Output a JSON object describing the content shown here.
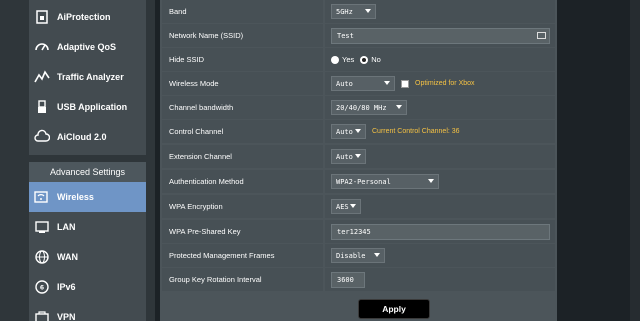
{
  "sidebar": {
    "items": [
      {
        "label": "AiProtection",
        "icon": "shield-icon"
      },
      {
        "label": "Adaptive QoS",
        "icon": "gauge-icon"
      },
      {
        "label": "Traffic Analyzer",
        "icon": "chart-icon"
      },
      {
        "label": "USB Application",
        "icon": "usb-icon"
      },
      {
        "label": "AiCloud 2.0",
        "icon": "cloud-icon"
      }
    ],
    "advanced_header": "Advanced Settings",
    "advanced_items": [
      {
        "label": "Wireless",
        "icon": "wifi-icon",
        "active": true
      },
      {
        "label": "LAN",
        "icon": "lan-icon"
      },
      {
        "label": "WAN",
        "icon": "globe-icon"
      },
      {
        "label": "IPv6",
        "icon": "ipv6-icon"
      },
      {
        "label": "VPN",
        "icon": "vpn-icon"
      }
    ]
  },
  "settings": {
    "band": {
      "label": "Band",
      "value": "5GHz"
    },
    "ssid": {
      "label": "Network Name (SSID)",
      "value": "Test"
    },
    "hide_ssid": {
      "label": "Hide SSID",
      "yes": "Yes",
      "no": "No",
      "selected": "No"
    },
    "wireless_mode": {
      "label": "Wireless Mode",
      "value": "Auto",
      "note": "Optimized for Xbox"
    },
    "channel_bandwidth": {
      "label": "Channel bandwidth",
      "value": "20/40/80 MHz"
    },
    "control_channel": {
      "label": "Control Channel",
      "value": "Auto",
      "note": "Current Control Channel: 36"
    },
    "extension_channel": {
      "label": "Extension Channel",
      "value": "Auto"
    },
    "auth_method": {
      "label": "Authentication Method",
      "value": "WPA2-Personal"
    },
    "wpa_encryption": {
      "label": "WPA Encryption",
      "value": "AES"
    },
    "wpa_psk": {
      "label": "WPA Pre-Shared Key",
      "value": "ter12345"
    },
    "pmf": {
      "label": "Protected Management Frames",
      "value": "Disable"
    },
    "group_key": {
      "label": "Group Key Rotation Interval",
      "value": "3600"
    }
  },
  "apply_label": "Apply",
  "colors": {
    "active": "#6f95c6",
    "note": "#f5c244"
  }
}
